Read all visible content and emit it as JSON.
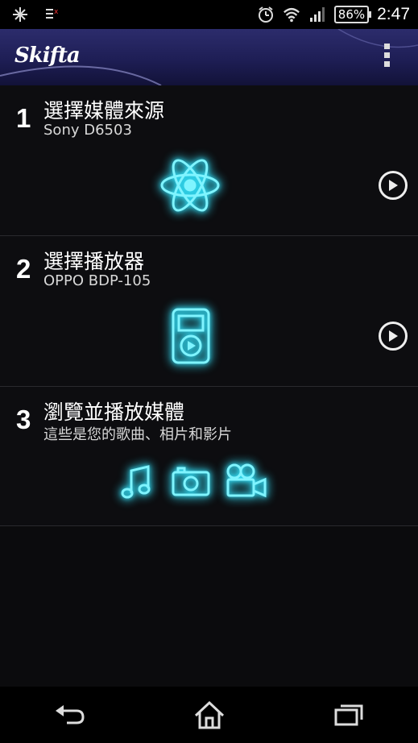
{
  "status_bar": {
    "time": "2:47",
    "battery": "86%",
    "icons": [
      "settings-sparkle-icon",
      "notification-icon",
      "alarm-icon",
      "wifi-icon",
      "signal-icon"
    ]
  },
  "app": {
    "logo": "Skifta"
  },
  "steps": [
    {
      "number": "1",
      "title": "選擇媒體來源",
      "subtitle": "Sony D6503",
      "icon": "atom-icon"
    },
    {
      "number": "2",
      "title": "選擇播放器",
      "subtitle": "OPPO BDP-105",
      "icon": "media-player-icon"
    },
    {
      "number": "3",
      "title": "瀏覽並播放媒體",
      "subtitle": "這些是您的歌曲、相片和影片",
      "icons": [
        "music-icon",
        "camera-icon",
        "video-camera-icon"
      ]
    }
  ],
  "colors": {
    "glow": "#33e6ff",
    "header": "#1e1e55"
  },
  "nav": [
    "back-icon",
    "home-icon",
    "recents-icon"
  ]
}
